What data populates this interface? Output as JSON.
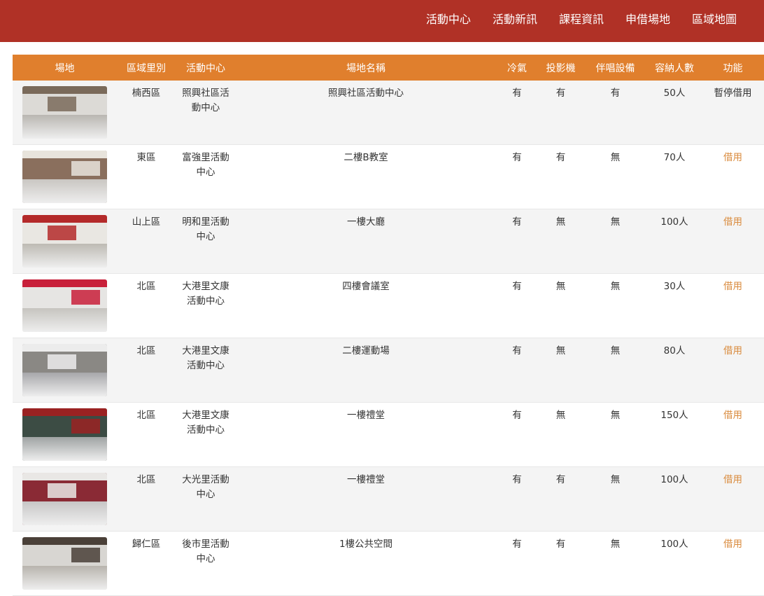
{
  "nav": {
    "items": [
      "活動中心",
      "活動新訊",
      "課程資訊",
      "申借場地",
      "區域地圖"
    ]
  },
  "table": {
    "headers": [
      "場地",
      "區域里別",
      "活動中心",
      "場地名稱",
      "冷氣",
      "投影機",
      "伴唱設備",
      "容納人數",
      "功能"
    ],
    "rows": [
      {
        "district": "楠西區",
        "center": "照興社區活動中心",
        "venue": "照興社區活動中心",
        "ac": "有",
        "projector": "有",
        "karaoke": "有",
        "capacity": "50人",
        "action": "暫停借用",
        "thumb": {
          "wall": "#dcdad6",
          "floor": "#b9b6b1",
          "accent": "#7a6a5a"
        }
      },
      {
        "district": "東區",
        "center": "富強里活動中心",
        "venue": "二樓B教室",
        "ac": "有",
        "projector": "有",
        "karaoke": "無",
        "capacity": "70人",
        "action": "借用",
        "thumb": {
          "wall": "#8a6f5d",
          "floor": "#c9c6c2",
          "accent": "#e8e4dc"
        }
      },
      {
        "district": "山上區",
        "center": "明和里活動中心",
        "venue": "一樓大廳",
        "ac": "有",
        "projector": "無",
        "karaoke": "無",
        "capacity": "100人",
        "action": "借用",
        "thumb": {
          "wall": "#e9e7e2",
          "floor": "#bdbab3",
          "accent": "#b42a2a"
        }
      },
      {
        "district": "北區",
        "center": "大港里文康活動中心",
        "venue": "四樓會議室",
        "ac": "有",
        "projector": "無",
        "karaoke": "無",
        "capacity": "30人",
        "action": "借用",
        "thumb": {
          "wall": "#e6e5e3",
          "floor": "#c6c4bf",
          "accent": "#c8203a"
        }
      },
      {
        "district": "北區",
        "center": "大港里文康活動中心",
        "venue": "二樓運動場",
        "ac": "有",
        "projector": "無",
        "karaoke": "無",
        "capacity": "80人",
        "action": "借用",
        "thumb": {
          "wall": "#8a8884",
          "floor": "#a7a7aa",
          "accent": "#ececec"
        }
      },
      {
        "district": "北區",
        "center": "大港里文康活動中心",
        "venue": "一樓禮堂",
        "ac": "有",
        "projector": "無",
        "karaoke": "無",
        "capacity": "150人",
        "action": "借用",
        "thumb": {
          "wall": "#3c4c44",
          "floor": "#9fa3a3",
          "accent": "#9a2222"
        }
      },
      {
        "district": "北區",
        "center": "大光里活動中心",
        "venue": "一樓禮堂",
        "ac": "有",
        "projector": "有",
        "karaoke": "無",
        "capacity": "100人",
        "action": "借用",
        "thumb": {
          "wall": "#8a2a35",
          "floor": "#c7c6c6",
          "accent": "#e9e7e5"
        }
      },
      {
        "district": "歸仁區",
        "center": "後市里活動中心",
        "venue": "1樓公共空間",
        "ac": "有",
        "projector": "有",
        "karaoke": "無",
        "capacity": "100人",
        "action": "借用",
        "thumb": {
          "wall": "#d8d6d2",
          "floor": "#b8b4ad",
          "accent": "#4a4038"
        }
      }
    ]
  },
  "colors": {
    "topbar": "#b03126",
    "header": "#e07f2d",
    "link": "#d98a3c"
  }
}
